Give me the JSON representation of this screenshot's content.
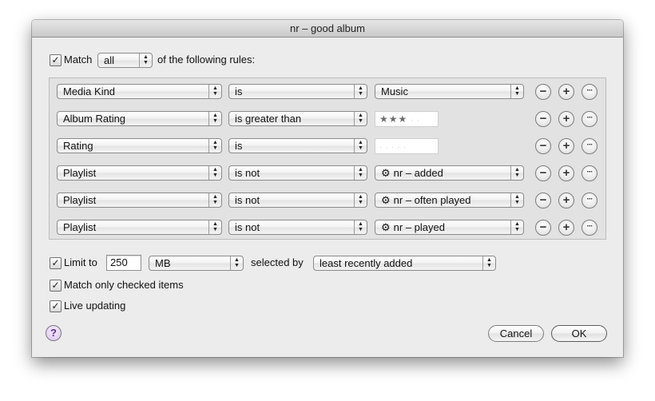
{
  "window": {
    "title": "nr – good album"
  },
  "match": {
    "checked": "✓",
    "label": "Match",
    "mode": "all",
    "suffix": "of the following rules:"
  },
  "rules": [
    {
      "field": "Media Kind",
      "op": "is",
      "value": "Music"
    },
    {
      "field": "Album Rating",
      "op": "is greater than",
      "stars_on": "★★★",
      "stars_off": "· ·"
    },
    {
      "field": "Rating",
      "op": "is",
      "stars_on": "",
      "stars_off": "· · · · ·"
    },
    {
      "field": "Playlist",
      "op": "is not",
      "value": "nr – added"
    },
    {
      "field": "Playlist",
      "op": "is not",
      "value": "nr – often played"
    },
    {
      "field": "Playlist",
      "op": "is not",
      "value": "nr – played"
    }
  ],
  "row_buttons": {
    "remove": "−",
    "add": "+",
    "more": "···"
  },
  "limit": {
    "checked": "✓",
    "label": "Limit to",
    "amount": "250",
    "unit": "MB",
    "selected_by_label": "selected by",
    "selected_by": "least recently added"
  },
  "match_checked": {
    "checked": "✓",
    "label": "Match only checked items"
  },
  "live_updating": {
    "checked": "✓",
    "label": "Live updating"
  },
  "buttons": {
    "help": "?",
    "cancel": "Cancel",
    "ok": "OK"
  },
  "icons": {
    "popup_arrows": "▲▼",
    "gear": "⚙"
  }
}
